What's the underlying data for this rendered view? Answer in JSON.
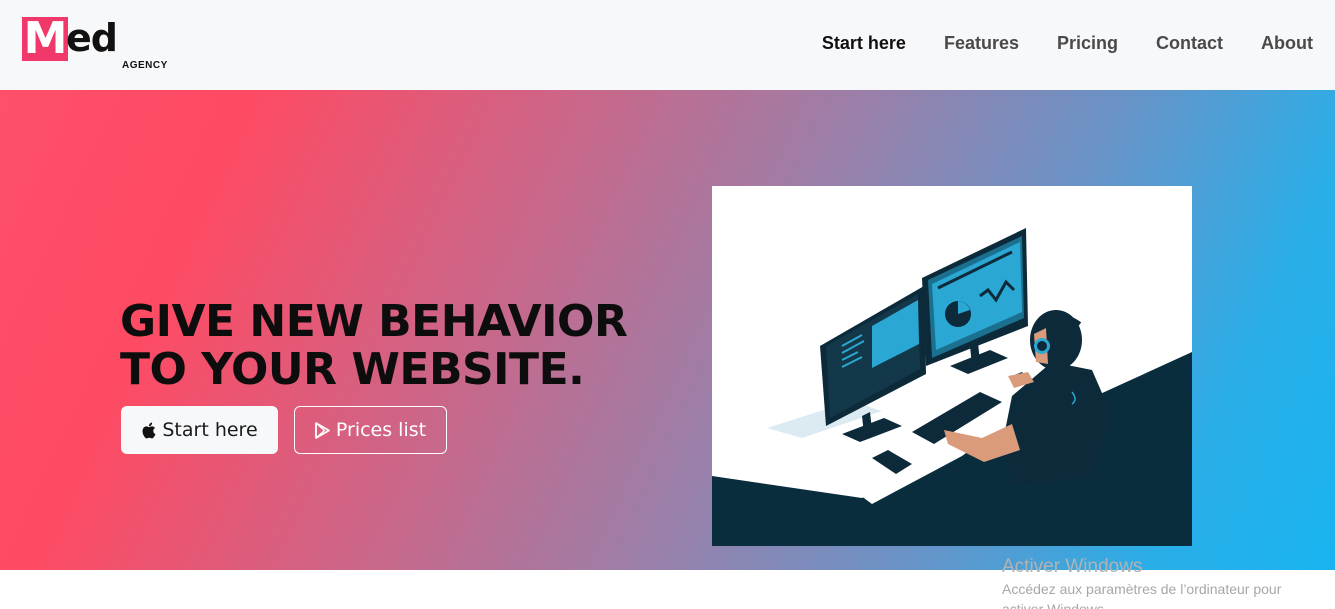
{
  "brand": {
    "logo_letter": "M",
    "logo_rest": "ed",
    "logo_sub": "AGENCY",
    "accent": "#f0386b"
  },
  "nav": {
    "items": [
      {
        "label": "Start here",
        "active": true
      },
      {
        "label": "Features",
        "active": false
      },
      {
        "label": "Pricing",
        "active": false
      },
      {
        "label": "Contact",
        "active": false
      },
      {
        "label": "About",
        "active": false
      }
    ]
  },
  "hero": {
    "headline_line1": "GIVE NEW BEHAVIOR",
    "headline_line2": "TO YOUR WEBSITE.",
    "primary_button": {
      "label": "Start here",
      "icon": "apple-icon"
    },
    "secondary_button": {
      "label": "Prices list",
      "icon": "google-play-icon"
    },
    "gradient": [
      "#ff4a63",
      "#18b4f0"
    ]
  },
  "watermark": {
    "title": "Activer Windows",
    "line1": "Accédez aux paramètres de l’ordinateur pour",
    "line2": "activer Windows."
  }
}
